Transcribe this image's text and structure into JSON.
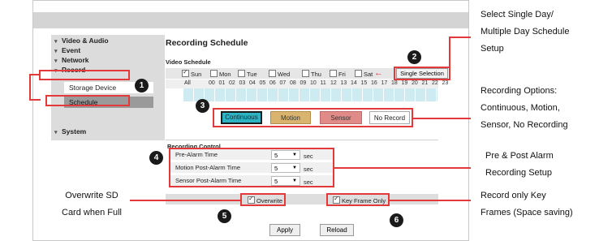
{
  "sidebar": {
    "video_audio": "Video & Audio",
    "event": "Event",
    "network": "Network",
    "record": "Record",
    "storage_device": "Storage Device",
    "schedule": "Schedule",
    "system": "System"
  },
  "main": {
    "title": "Recording Schedule",
    "video_schedule_label": "Video Schedule",
    "days": [
      {
        "label": "Sun",
        "checked": true
      },
      {
        "label": "Mon",
        "checked": false
      },
      {
        "label": "Tue",
        "checked": false
      },
      {
        "label": "Wed",
        "checked": false
      },
      {
        "label": "Thu",
        "checked": false
      },
      {
        "label": "Fri",
        "checked": false
      },
      {
        "label": "Sat",
        "checked": false
      }
    ],
    "single_selection_label": "Single Selection",
    "all_label": "All",
    "hours": [
      "00",
      "01",
      "02",
      "03",
      "04",
      "05",
      "06",
      "07",
      "08",
      "09",
      "10",
      "11",
      "12",
      "13",
      "14",
      "15",
      "16",
      "17",
      "18",
      "19",
      "20",
      "21",
      "22",
      "23"
    ],
    "modes": {
      "continuous": "Continuous",
      "motion": "Motion",
      "sensor": "Sensor",
      "no_record": "No Record"
    },
    "recording_control_label": "Recording Control",
    "controls": [
      {
        "label": "Pre-Alarm Time",
        "value": "5",
        "unit": "sec"
      },
      {
        "label": "Motion Post-Alarm Time",
        "value": "5",
        "unit": "sec"
      },
      {
        "label": "Sensor Post-Alarm Time",
        "value": "5",
        "unit": "sec"
      }
    ],
    "overwrite_label": "Overwrite",
    "key_frame_label": "Key Frame Only",
    "apply_label": "Apply",
    "reload_label": "Reload"
  },
  "annotations": {
    "badges": [
      "1",
      "2",
      "3",
      "4",
      "5",
      "6"
    ],
    "note_day_1": "Select Single Day/",
    "note_day_2": "Multiple Day Schedule",
    "note_day_3": "Setup",
    "note_opts_1": "Recording Options:",
    "note_opts_2": "Continuous, Motion,",
    "note_opts_3": "Sensor, No Recording",
    "note_alarm_1": "Pre & Post Alarm",
    "note_alarm_2": "Recording Setup",
    "note_key_1": "Record only Key",
    "note_key_2": "Frames (Space saving)",
    "note_ow_1": "Overwrite SD",
    "note_ow_2": "Card when Full"
  },
  "colors": {
    "annotation_red": "#e23a3a",
    "continuous": "#2eb3c4",
    "motion": "#d9b46e",
    "sensor": "#e08b88",
    "grid_cell": "#cdebf0"
  }
}
